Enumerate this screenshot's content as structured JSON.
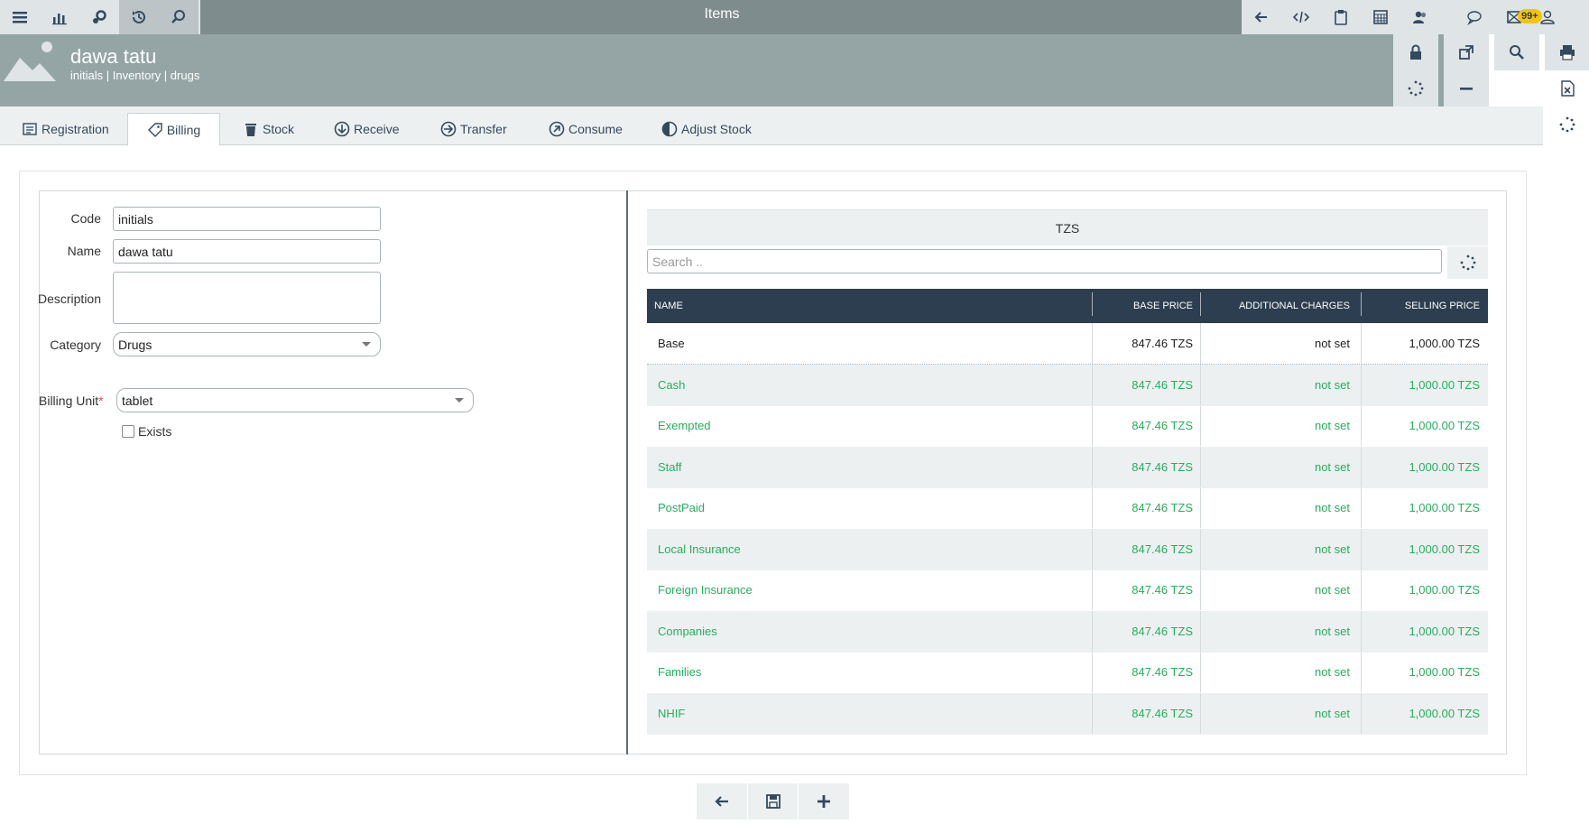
{
  "window": {
    "title": "Items"
  },
  "topbar": {
    "left_icons": [
      "menu-icon",
      "chart-icon",
      "settings-icon",
      "history-icon",
      "search-icon"
    ],
    "right_icons": [
      "back-icon",
      "code-icon",
      "clipboard-icon",
      "calculator-icon",
      "users-icon",
      "chat-icon",
      "mail-icon",
      "user-icon"
    ],
    "mail_badge": "99+"
  },
  "header": {
    "name": "dawa tatu",
    "subtitle": "initials | Inventory | drugs"
  },
  "tabs": [
    {
      "label": "Registration",
      "icon": "registration-icon"
    },
    {
      "label": "Billing",
      "icon": "tag-icon"
    },
    {
      "label": "Stock",
      "icon": "trash-icon"
    },
    {
      "label": "Receive",
      "icon": "arrow-down-circle-icon"
    },
    {
      "label": "Transfer",
      "icon": "arrow-right-circle-icon"
    },
    {
      "label": "Consume",
      "icon": "arrow-up-right-circle-icon"
    },
    {
      "label": "Adjust Stock",
      "icon": "half-circle-icon"
    }
  ],
  "form": {
    "code_label": "Code",
    "code_value": "initials",
    "name_label": "Name",
    "name_value": "dawa tatu",
    "description_label": "Description",
    "description_value": "",
    "category_label": "Category",
    "category_value": "Drugs",
    "billing_unit_label": "Billing Unit",
    "billing_unit_required": "*",
    "billing_unit_value": "tablet",
    "exists_label": "Exists",
    "exists_checked": false
  },
  "pricing": {
    "currency_header": "TZS",
    "search_placeholder": "Search ..",
    "columns": [
      "NAME",
      "BASE PRICE",
      "ADDITIONAL CHARGES",
      "SELLING PRICE"
    ],
    "rows": [
      {
        "name": "Base",
        "base_price": "847.46 TZS",
        "additional": "not set",
        "selling": "1,000.00 TZS"
      },
      {
        "name": "Cash",
        "base_price": "847.46 TZS",
        "additional": "not set",
        "selling": "1,000.00 TZS"
      },
      {
        "name": "Exempted",
        "base_price": "847.46 TZS",
        "additional": "not set",
        "selling": "1,000.00 TZS"
      },
      {
        "name": "Staff",
        "base_price": "847.46 TZS",
        "additional": "not set",
        "selling": "1,000.00 TZS"
      },
      {
        "name": "PostPaid",
        "base_price": "847.46 TZS",
        "additional": "not set",
        "selling": "1,000.00 TZS"
      },
      {
        "name": "Local Insurance",
        "base_price": "847.46 TZS",
        "additional": "not set",
        "selling": "1,000.00 TZS"
      },
      {
        "name": "Foreign Insurance",
        "base_price": "847.46 TZS",
        "additional": "not set",
        "selling": "1,000.00 TZS"
      },
      {
        "name": "Companies",
        "base_price": "847.46 TZS",
        "additional": "not set",
        "selling": "1,000.00 TZS"
      },
      {
        "name": "Families",
        "base_price": "847.46 TZS",
        "additional": "not set",
        "selling": "1,000.00 TZS"
      },
      {
        "name": "NHIF",
        "base_price": "847.46 TZS",
        "additional": "not set",
        "selling": "1,000.00 TZS"
      }
    ]
  },
  "colors": {
    "topbar": "#7f8c8d",
    "header": "#95a5a6",
    "table_header": "#2c3e50",
    "category_text": "#27ae60",
    "badge": "#f1c40f"
  }
}
